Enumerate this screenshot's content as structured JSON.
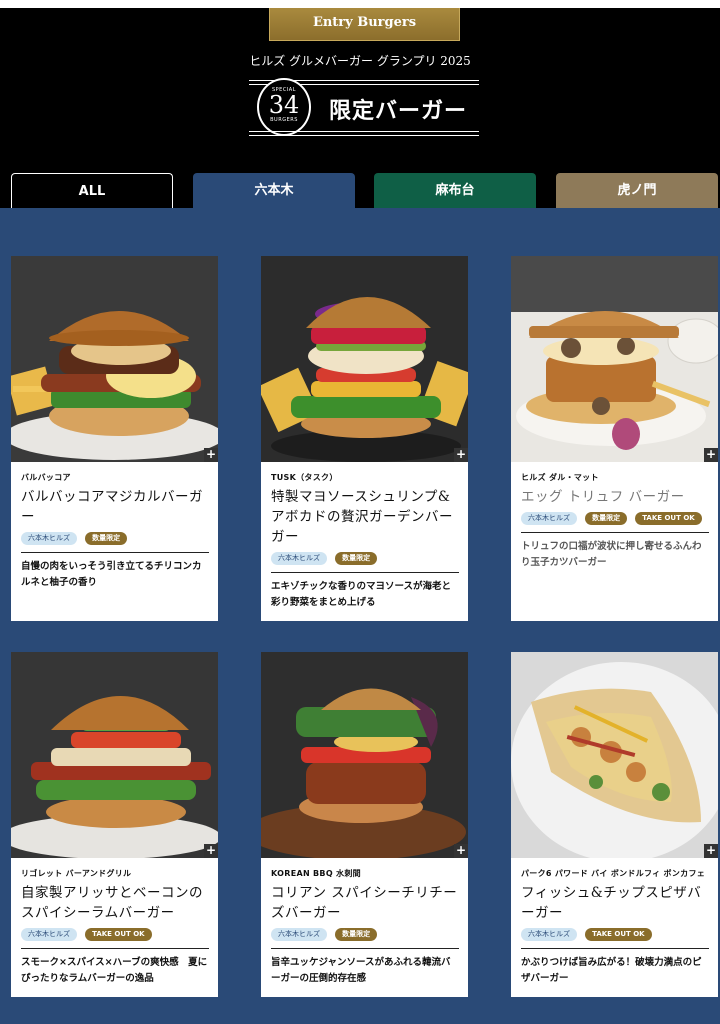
{
  "header": {
    "entry_label": "Entry Burgers",
    "grand_prix": "ヒルズ グルメバーガー グランプリ 2025",
    "badge_top": "SPECIAL",
    "badge_number": "34",
    "badge_bottom": "BURGERS",
    "title": "限定バーガー"
  },
  "tabs": [
    {
      "label": "ALL"
    },
    {
      "label": "六本木"
    },
    {
      "label": "麻布台"
    },
    {
      "label": "虎ノ門"
    }
  ],
  "cards": [
    {
      "restaurant": "バルバッコア",
      "name": "バルバッコアマジカルバーガー",
      "tags": [
        "六本木ヒルズ",
        "数量限定"
      ],
      "description": "自慢の肉をいっそう引き立てるチリコンカルネと柚子の香り",
      "image": "burger-with-bacon-and-fries"
    },
    {
      "restaurant": "TUSK（タスク）",
      "name": "特製マヨソースシュリンプ&アボカドの贅沢ガーデンバーガー",
      "tags": [
        "六本木ヒルズ",
        "数量限定"
      ],
      "description": "エキゾチックな香りのマヨソースが海老と彩り野菜をまとめ上げる",
      "image": "shrimp-avocado-burger"
    },
    {
      "restaurant": "ヒルズ ダル・マット",
      "name": "エッグ トリュフ バーガー",
      "tags": [
        "六本木ヒルズ",
        "数量限定",
        "TAKE OUT OK"
      ],
      "description": "トリュフの口福が波状に押し寄せるふんわり玉子カツバーガー",
      "image": "truffle-egg-burger"
    },
    {
      "restaurant": "リゴレット バーアンドグリル",
      "name": "自家製アリッサとベーコンのスパイシーラムバーガー",
      "tags": [
        "六本木ヒルズ",
        "TAKE OUT OK"
      ],
      "description": "スモーク×スパイス×ハーブの爽快感　夏にぴったりなラムバーガーの逸品",
      "image": "spicy-lamb-burger"
    },
    {
      "restaurant": "KOREAN BBQ 水刺間",
      "name": "コリアン スパイシーチリチーズバーガー",
      "tags": [
        "六本木ヒルズ",
        "数量限定"
      ],
      "description": "旨辛ユッケジャンソースがあふれる韓流バーガーの圧倒的存在感",
      "image": "korean-chili-cheese-burger"
    },
    {
      "restaurant": "パーク6 パワード バイ ボンドルフィ ボンカフェ",
      "name": "フィッシュ&チップスピザバーガー",
      "tags": [
        "六本木ヒルズ",
        "TAKE OUT OK"
      ],
      "description": "かぶりつけば旨み広がる！破壊力満点のピザバーガー",
      "image": "fish-pizza-burger"
    }
  ]
}
